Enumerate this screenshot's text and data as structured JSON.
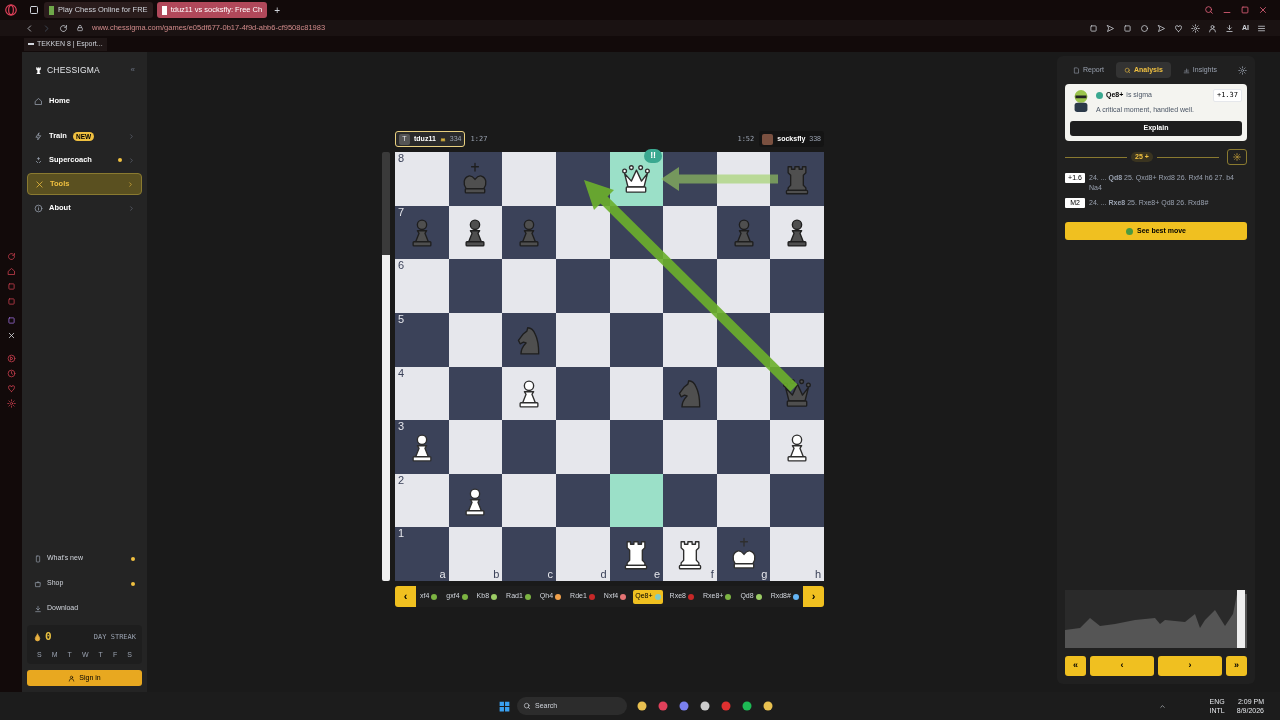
{
  "browser": {
    "tabs": [
      {
        "title": "Play Chess Online for FRE",
        "selected": false
      },
      {
        "title": "tduz11 vs socksfly: Free Ch",
        "selected": true
      }
    ],
    "new_tab": "+",
    "url": "www.chessigma.com/games/e05df677-0b17-4f9d-abb6-cf9508c81983",
    "ai_label": "AI",
    "bookmark": "TEKKEN 8 | Esport..."
  },
  "sidebar": {
    "logo": "CHESSIGMA",
    "collapse": "«",
    "items": [
      {
        "label": "Home",
        "dot": false,
        "chevron": false,
        "selected": false
      },
      {
        "label": "Train",
        "badge": "NEW",
        "dot": false,
        "chevron": true,
        "selected": false
      },
      {
        "label": "Supercoach",
        "dot": true,
        "chevron": true,
        "selected": false
      },
      {
        "label": "Tools",
        "dot": false,
        "chevron": true,
        "selected": true
      },
      {
        "label": "About",
        "dot": false,
        "chevron": true,
        "selected": false
      }
    ],
    "bottom_items": [
      {
        "label": "What's new",
        "dot": true
      },
      {
        "label": "Shop",
        "dot": true
      },
      {
        "label": "Download",
        "dot": false
      }
    ],
    "streak": {
      "count": "0",
      "label": "DAY STREAK",
      "days": [
        "S",
        "M",
        "T",
        "W",
        "T",
        "F",
        "S"
      ]
    },
    "sign_in": "Sign in"
  },
  "players": {
    "top": {
      "initial": "T",
      "name": "tduz11",
      "rating": "334",
      "clock": "1:27",
      "active": true
    },
    "bottom": {
      "clock": "1:52",
      "name": "socksfly",
      "rating": "338",
      "active": false
    }
  },
  "eval_bar": {
    "level": 0.76
  },
  "board": {
    "ranks": [
      {
        "label": "8",
        "squares": [
          {
            "highlighted": false
          },
          {
            "highlighted": false,
            "kind": "king",
            "color": "#4f4f4f"
          },
          {
            "highlighted": false
          },
          {
            "highlighted": false
          },
          {
            "highlighted": true,
            "kind": "queen",
            "color": "#ffffff",
            "badge": "!!"
          },
          {
            "highlighted": false
          },
          {
            "highlighted": false
          },
          {
            "highlighted": false,
            "kind": "rook",
            "color": "#4f4f4f"
          }
        ]
      },
      {
        "label": "7",
        "squares": [
          {
            "highlighted": false,
            "kind": "pawn",
            "color": "#4f4f4f"
          },
          {
            "highlighted": false,
            "kind": "pawn",
            "color": "#4f4f4f"
          },
          {
            "highlighted": false,
            "kind": "pawn",
            "color": "#4f4f4f"
          },
          {
            "highlighted": false
          },
          {
            "highlighted": false
          },
          {
            "highlighted": false
          },
          {
            "highlighted": false,
            "kind": "pawn",
            "color": "#4f4f4f"
          },
          {
            "highlighted": false,
            "kind": "pawn",
            "color": "#4f4f4f"
          }
        ]
      },
      {
        "label": "6",
        "squares": [
          {
            "highlighted": false
          },
          {
            "highlighted": false
          },
          {
            "highlighted": false
          },
          {
            "highlighted": false
          },
          {
            "highlighted": false
          },
          {
            "highlighted": false
          },
          {
            "highlighted": false
          },
          {
            "highlighted": false
          }
        ]
      },
      {
        "label": "5",
        "squares": [
          {
            "highlighted": false
          },
          {
            "highlighted": false
          },
          {
            "highlighted": false,
            "kind": "knight",
            "color": "#4f4f4f"
          },
          {
            "highlighted": false
          },
          {
            "highlighted": false
          },
          {
            "highlighted": false
          },
          {
            "highlighted": false
          },
          {
            "highlighted": false
          }
        ]
      },
      {
        "label": "4",
        "squares": [
          {
            "highlighted": false
          },
          {
            "highlighted": false
          },
          {
            "highlighted": false,
            "kind": "pawn",
            "color": "#ffffff"
          },
          {
            "highlighted": false
          },
          {
            "highlighted": false
          },
          {
            "highlighted": false,
            "kind": "knight",
            "color": "#4f4f4f"
          },
          {
            "highlighted": false
          },
          {
            "highlighted": false,
            "kind": "queen",
            "color": "#4f4f4f"
          }
        ]
      },
      {
        "label": "3",
        "squares": [
          {
            "highlighted": false,
            "kind": "pawn",
            "color": "#ffffff"
          },
          {
            "highlighted": false
          },
          {
            "highlighted": false
          },
          {
            "highlighted": false
          },
          {
            "highlighted": false
          },
          {
            "highlighted": false
          },
          {
            "highlighted": false
          },
          {
            "highlighted": false,
            "kind": "pawn",
            "color": "#ffffff"
          }
        ]
      },
      {
        "label": "2",
        "squares": [
          {
            "highlighted": false
          },
          {
            "highlighted": false,
            "kind": "pawn",
            "color": "#ffffff"
          },
          {
            "highlighted": false
          },
          {
            "highlighted": false
          },
          {
            "highlighted": true
          },
          {
            "highlighted": false
          },
          {
            "highlighted": false
          },
          {
            "highlighted": false
          }
        ]
      },
      {
        "label": "1",
        "squares": [
          {
            "highlighted": false
          },
          {
            "highlighted": false
          },
          {
            "highlighted": false
          },
          {
            "highlighted": false
          },
          {
            "highlighted": false,
            "kind": "rook",
            "color": "#ffffff"
          },
          {
            "highlighted": false,
            "kind": "rook",
            "color": "#ffffff"
          },
          {
            "highlighted": false,
            "kind": "king",
            "color": "#ffffff"
          },
          {
            "highlighted": false
          }
        ]
      }
    ],
    "files": [
      "a",
      "b",
      "c",
      "d",
      "e",
      "f",
      "g",
      "h"
    ]
  },
  "moves": {
    "prev": "‹",
    "next": "›",
    "items": [
      {
        "san": "xf4",
        "color": "#7cb342",
        "selected": false
      },
      {
        "san": "gxf4",
        "color": "#7cb342",
        "selected": false
      },
      {
        "san": "Kb8",
        "color": "#9ccc65",
        "selected": false
      },
      {
        "san": "Rad1",
        "color": "#7cb342",
        "selected": false
      },
      {
        "san": "Qh4",
        "color": "#f0a04b",
        "selected": false
      },
      {
        "san": "Rde1",
        "color": "#c62828",
        "selected": false
      },
      {
        "san": "Nxf4",
        "color": "#e57373",
        "selected": false
      },
      {
        "san": "Qe8+",
        "color": "#80cbc4",
        "selected": true
      },
      {
        "san": "Rxe8",
        "color": "#c62828",
        "selected": false
      },
      {
        "san": "Rxe8+",
        "color": "#7cb342",
        "selected": false
      },
      {
        "san": "Qd8",
        "color": "#9ccc65",
        "selected": false
      },
      {
        "san": "Rxd8#",
        "color": "#64b5f6",
        "selected": false
      }
    ]
  },
  "panel": {
    "tabs": [
      {
        "label": "Report",
        "selected": false
      },
      {
        "label": "Analysis",
        "selected": true
      },
      {
        "label": "Insights",
        "selected": false
      }
    ],
    "coach": {
      "move": "Qe8+",
      "verdict": "is sigma",
      "eval": "+1.37",
      "message": "A critical moment, handled well.",
      "button": "Explain"
    },
    "depth": "25 +",
    "lines": [
      {
        "eval": "+1.6",
        "moves": "24. ... **Qd8** 25. Qxd8+ Rxd8 26. Rxf4 h6 27. b4 Na4"
      },
      {
        "eval": "M2",
        "moves": "24. ... **Rxe8** 25. Rxe8+ Qd8 26. Rxd8#"
      }
    ],
    "best_move": "See best move",
    "nav": [
      "«",
      "‹",
      "›",
      "»"
    ]
  },
  "taskbar": {
    "search": "Search",
    "language": [
      "ENG",
      "INTL"
    ],
    "time": "2:09 PM",
    "date": "8/9/2026"
  }
}
